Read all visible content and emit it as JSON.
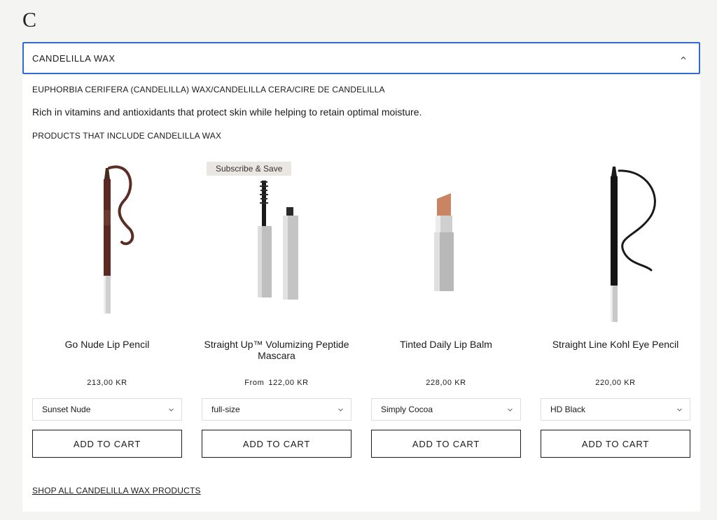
{
  "section_letter": "C",
  "accordion": {
    "title": "CANDELILLA WAX",
    "inci": "EUPHORBIA CERIFERA (CANDELILLA) WAX/CANDELILLA CERA/CIRE DE CANDELILLA",
    "description": "Rich in vitamins and antioxidants that protect skin while helping to retain optimal moisture.",
    "products_heading": "PRODUCTS THAT INCLUDE CANDELILLA WAX",
    "shop_all_link": "SHOP ALL CANDELILLA WAX PRODUCTS"
  },
  "products": [
    {
      "name": "Go Nude Lip Pencil",
      "price_prefix": "",
      "price": "213,00 KR",
      "variant": "Sunset Nude",
      "cta": "ADD TO CART",
      "badge": "",
      "icon": "lip-pencil-icon"
    },
    {
      "name": "Straight Up™ Volumizing Peptide Mascara",
      "price_prefix": "From",
      "price": "122,00 KR",
      "variant": "full-size",
      "cta": "ADD TO CART",
      "badge": "Subscribe & Save",
      "icon": "mascara-icon"
    },
    {
      "name": "Tinted Daily Lip Balm",
      "price_prefix": "",
      "price": "228,00 KR",
      "variant": "Simply Cocoa",
      "cta": "ADD TO CART",
      "badge": "",
      "icon": "lip-balm-icon"
    },
    {
      "name": "Straight Line Kohl Eye Pencil",
      "price_prefix": "",
      "price": "220,00 KR",
      "variant": "HD Black",
      "cta": "ADD TO CART",
      "badge": "",
      "icon": "eye-pencil-icon"
    }
  ],
  "colors": {
    "focus_border": "#2f6ad0",
    "badge_bg": "#eae6e2",
    "page_bg": "#f4f4f2"
  }
}
